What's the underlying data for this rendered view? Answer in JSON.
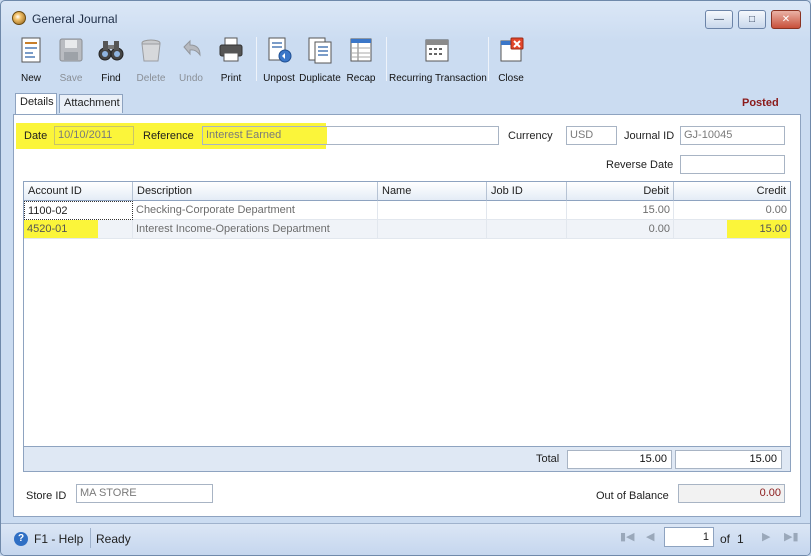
{
  "window": {
    "title": "General Journal"
  },
  "toolbar": {
    "new": "New",
    "save": "Save",
    "find": "Find",
    "delete": "Delete",
    "undo": "Undo",
    "print": "Print",
    "unpost": "Unpost",
    "duplicate": "Duplicate",
    "recap": "Recap",
    "recurring": "Recurring Transaction",
    "close": "Close"
  },
  "tabs": {
    "details": "Details",
    "attachment": "Attachment"
  },
  "status": "Posted",
  "form": {
    "date_label": "Date",
    "date_value": "10/10/2011",
    "reference_label": "Reference",
    "reference_value": "Interest Earned",
    "currency_label": "Currency",
    "currency_value": "USD",
    "journal_label": "Journal ID",
    "journal_value": "GJ-10045",
    "reverse_label": "Reverse Date",
    "reverse_value": ""
  },
  "grid": {
    "headers": [
      "Account ID",
      "Description",
      "Name",
      "Job ID",
      "Debit",
      "Credit"
    ],
    "rows": [
      {
        "account": "1100-02",
        "description": "Checking-Corporate Department",
        "name": "",
        "job": "",
        "debit": "15.00",
        "credit": "0.00"
      },
      {
        "account": "4520-01",
        "description": "Interest Income-Operations Department",
        "name": "",
        "job": "",
        "debit": "0.00",
        "credit": "15.00"
      }
    ],
    "total_label": "Total",
    "total_debit": "15.00",
    "total_credit": "15.00"
  },
  "footer": {
    "store_label": "Store ID",
    "store_value": "MA STORE",
    "oob_label": "Out of Balance",
    "oob_value": "0.00"
  },
  "statusbar": {
    "help": "F1 - Help",
    "ready": "Ready",
    "page": "1",
    "of": "of",
    "total_pages": "1"
  },
  "colors": {
    "highlight": "#fbf53a",
    "posted": "#8b1a1a",
    "oob": "#8b1a1a"
  }
}
